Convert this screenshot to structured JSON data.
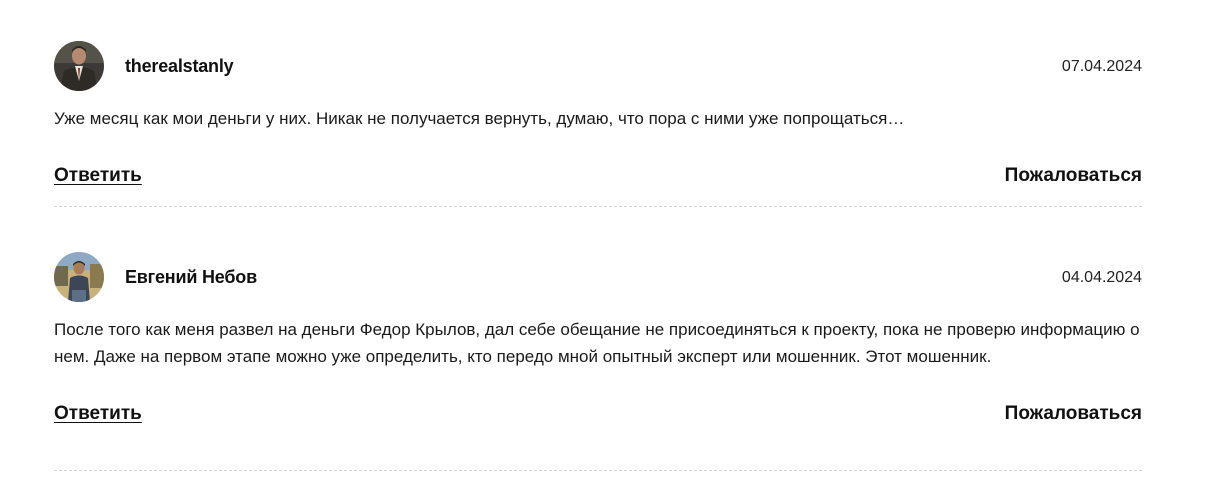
{
  "comments": [
    {
      "author": "therealstanly",
      "date": "07.04.2024",
      "text": "Уже месяц как мои деньги у них. Никак не получается вернуть, думаю, что пора с ними уже попрощаться…",
      "reply_label": "Ответить",
      "report_label": "Пожаловаться"
    },
    {
      "author": "Евгений Небов",
      "date": "04.04.2024",
      "text": "После того как меня развел на деньги Федор Крылов, дал себе обещание не присоединяться к проекту, пока не проверю информацию о нем. Даже на первом этапе можно уже определить, кто передо мной опытный эксперт или мошенник. Этот мошенник.",
      "reply_label": "Ответить",
      "report_label": "Пожаловаться"
    }
  ]
}
